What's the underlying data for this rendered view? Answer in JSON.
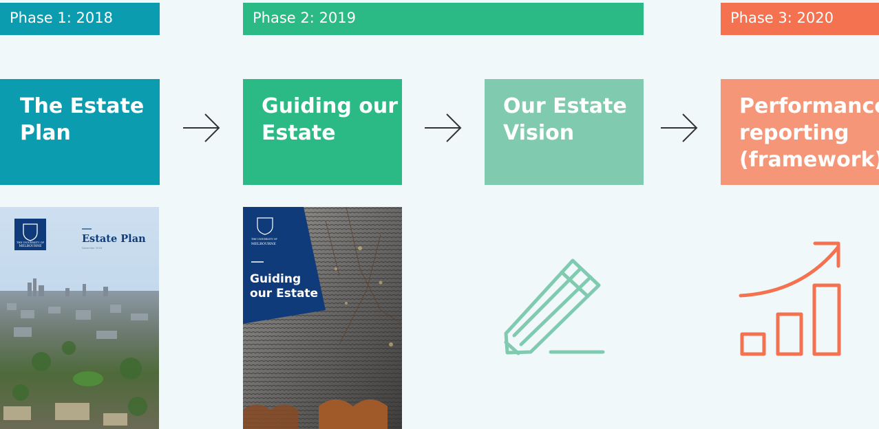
{
  "colors": {
    "teal": "#0c9cb0",
    "green": "#2bb985",
    "light_green": "#80cab0",
    "coral": "#f4724f",
    "salmon": "#f59678",
    "navy": "#0f3b7a",
    "background": "#f0f8fa"
  },
  "phases": [
    {
      "label": "Phase 1: 2018"
    },
    {
      "label": "Phase 2: 2019"
    },
    {
      "label": "Phase 3: 2020"
    }
  ],
  "steps": [
    {
      "lines": [
        "The Estate",
        "Plan"
      ]
    },
    {
      "lines": [
        "Guiding our",
        "Estate"
      ]
    },
    {
      "lines": [
        "Our Estate",
        "Vision"
      ]
    },
    {
      "lines": [
        "Performance",
        "reporting",
        "(framework)"
      ]
    }
  ],
  "documents": {
    "estate_plan": {
      "logo_top": "THE UNIVERSITY OF",
      "logo_bottom": "MELBOURNE",
      "title": "Estate Plan",
      "date": "November 2018"
    },
    "guiding": {
      "logo_top": "THE UNIVERSITY OF",
      "logo_bottom": "MELBOURNE",
      "title_line1": "Guiding",
      "title_line2": "our Estate"
    }
  },
  "icons": [
    "arrow-right-icon",
    "pencil-icon",
    "growth-chart-icon"
  ]
}
